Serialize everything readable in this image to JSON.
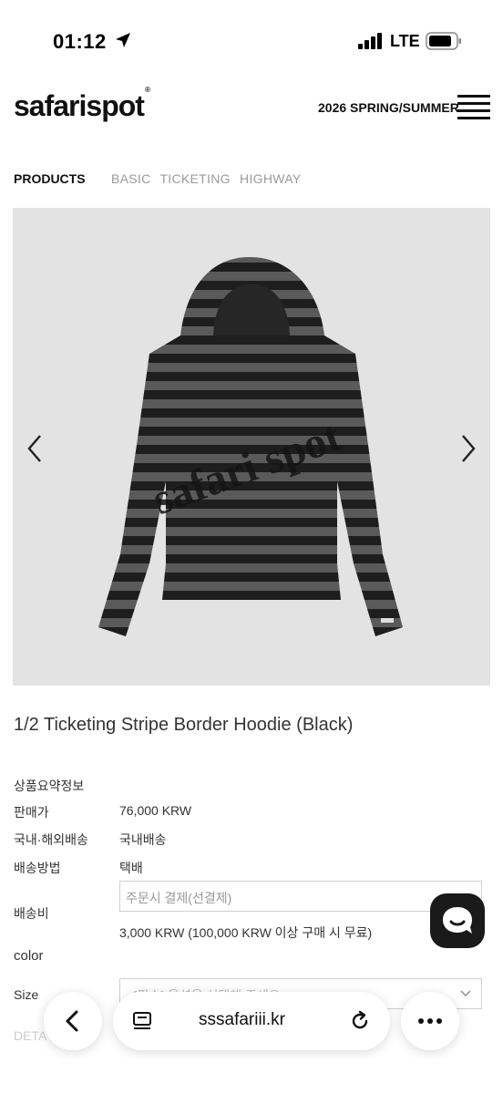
{
  "status": {
    "time": "01:12",
    "network": "LTE"
  },
  "header": {
    "logo": "safarispot",
    "logo_mark": "®",
    "season": "2026 SPRING/SUMMER"
  },
  "nav": {
    "active": "PRODUCTS",
    "items": [
      "BASIC",
      "TICKETING",
      "HIGHWAY"
    ]
  },
  "product": {
    "title": "1/2 Ticketing Stripe Border Hoodie (Black)",
    "image_lettering": "safari spot"
  },
  "info": {
    "summary_label": "상품요약정보",
    "price_label": "판매가",
    "price_value": "76,000 KRW",
    "shipping_scope_label": "국내·해외배송",
    "shipping_scope_value": "국내배송",
    "shipping_method_label": "배송방법",
    "shipping_method_value": "택배",
    "shipping_fee_label": "배송비",
    "shipping_fee_select": "주문시 결제(선결제)",
    "shipping_fee_note": "3,000 KRW (100,000 KRW 이상 구매 시 무료)",
    "color_label": "color",
    "size_label": "Size",
    "size_select_peek": "- [필수] 옵션을 선택해 주세요 -",
    "detail_peek": "DETA"
  },
  "browser": {
    "url": "sssafariii.kr"
  },
  "colors": {
    "accent": "#111111",
    "image_bg": "#e3e3e3",
    "stripe_dark": "#1e1e1e",
    "stripe_light": "#5a5a5a"
  }
}
